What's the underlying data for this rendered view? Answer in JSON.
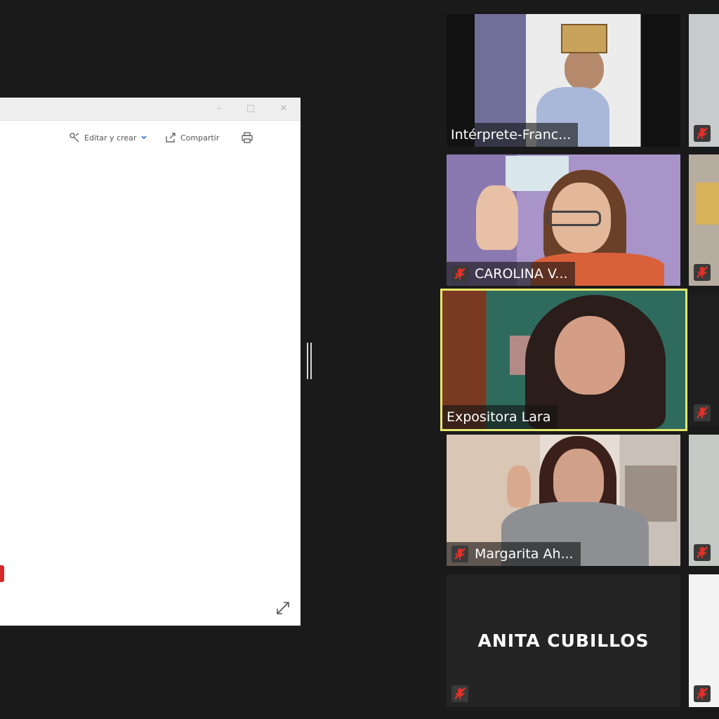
{
  "shared_window": {
    "toolbar": {
      "edit_label": "Editar y crear",
      "share_label": "Compartir"
    }
  },
  "participants": [
    {
      "name": "Intérprete-Franc...",
      "muted": false
    },
    {
      "name": "CAROLINA V...",
      "muted": true
    },
    {
      "name": "Expositora Lara",
      "muted": false,
      "active_speaker": true
    },
    {
      "name": "Margarita Ah...",
      "muted": true
    },
    {
      "name": "ANITA CUBILLOS",
      "muted": true,
      "video_off": true
    }
  ],
  "colors": {
    "background": "#1a1a1a",
    "active_speaker_border": "#e6e86c",
    "mute_red": "#e0302a"
  },
  "icons": {
    "mute": "mic-muted-icon",
    "expand": "expand-icon",
    "print": "print-icon",
    "share": "share-icon",
    "edit": "edit-create-icon"
  }
}
